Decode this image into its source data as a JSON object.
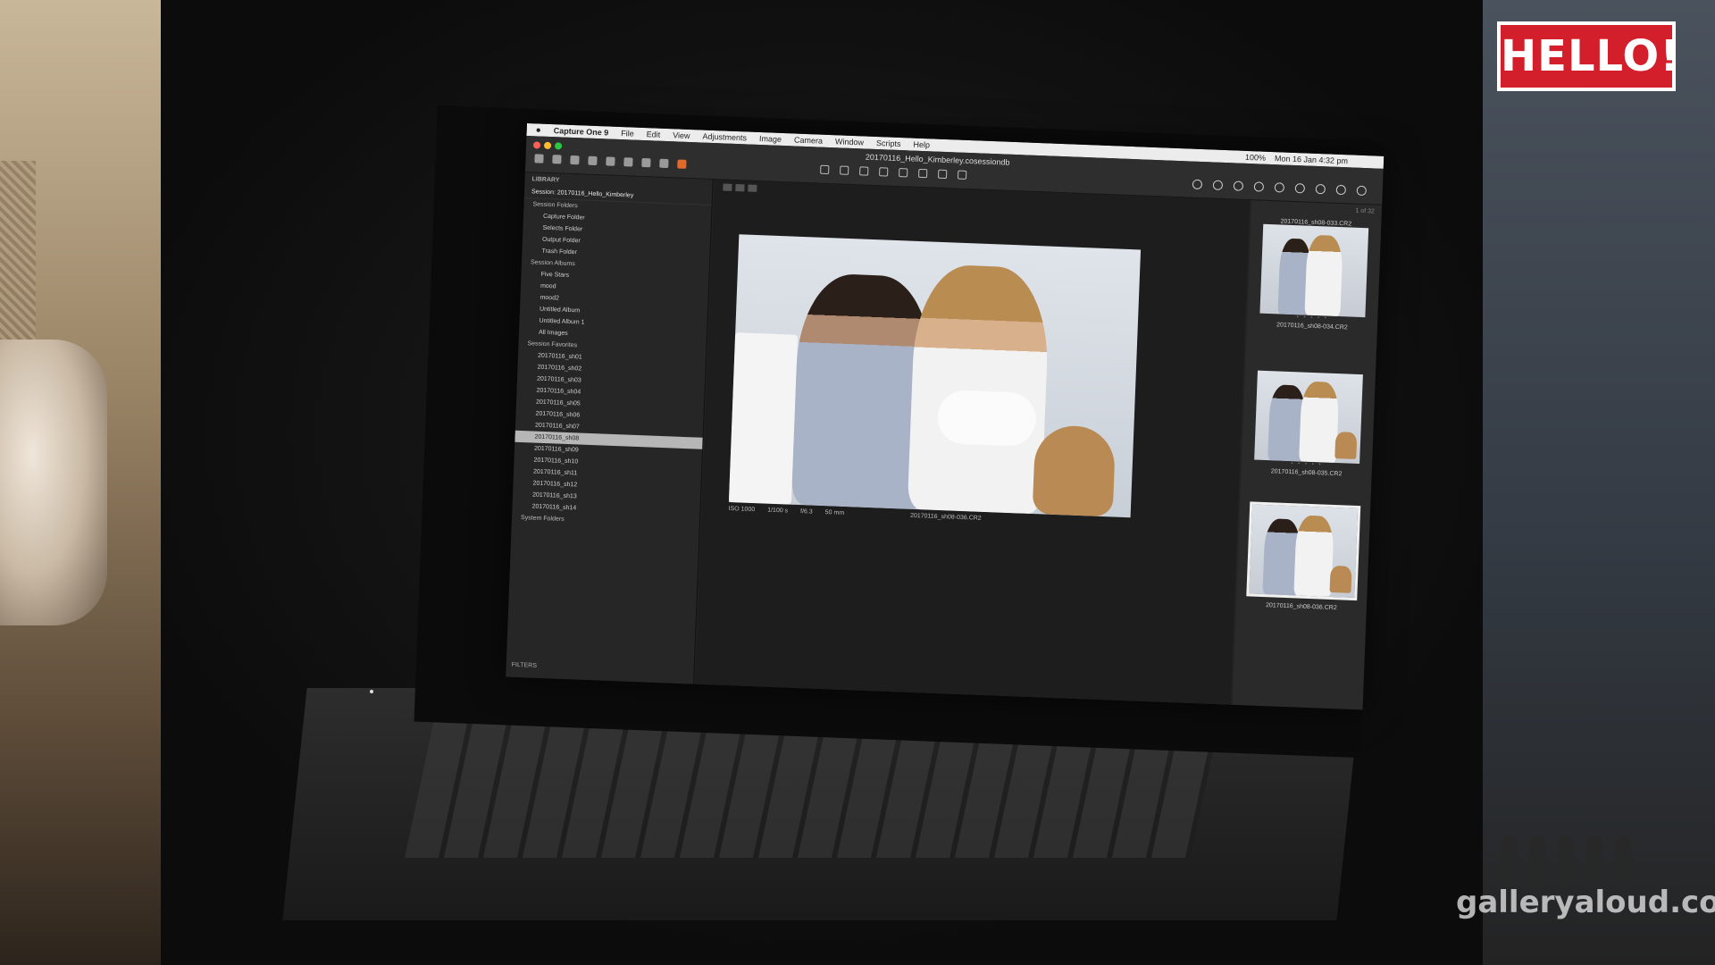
{
  "overlay": {
    "logo_text": "HELLO!",
    "watermark": "galleryaloud.com"
  },
  "menubar": {
    "apple": "",
    "app_name": "Capture One 9",
    "items": [
      "File",
      "Edit",
      "View",
      "Adjustments",
      "Image",
      "Camera",
      "Window",
      "Scripts",
      "Help"
    ],
    "status": [
      "100%",
      "Mon 16 Jan 4:32 pm"
    ]
  },
  "window": {
    "title": "20170116_Hello_Kimberley.cosessiondb"
  },
  "library": {
    "header": "LIBRARY",
    "session": "Session: 20170116_Hello_Kimberley",
    "session_folders_label": "Session Folders",
    "folders": [
      "Capture Folder",
      "Selects Folder",
      "Output Folder",
      "Trash Folder"
    ],
    "albums_label": "Session Albums",
    "albums": [
      "Five Stars",
      "mood",
      "mood2",
      "Untitled Album",
      "Untitled Album 1",
      "All Images"
    ],
    "favorites_label": "Session Favorites",
    "favorites": [
      "20170116_sh01",
      "20170116_sh02",
      "20170116_sh03",
      "20170116_sh04",
      "20170116_sh05",
      "20170116_sh06",
      "20170116_sh07",
      "20170116_sh08",
      "20170116_sh09",
      "20170116_sh10",
      "20170116_sh11",
      "20170116_sh12",
      "20170116_sh13",
      "20170116_sh14"
    ],
    "selected_index": 7,
    "system_folders_label": "System Folders",
    "filters_label": "FILTERS"
  },
  "viewer": {
    "meta": [
      "ISO 1000",
      "1/100 s",
      "f/6.3",
      "50 mm"
    ],
    "filename": "20170116_sh08-036.CR2"
  },
  "browser": {
    "counter": "1 of 32",
    "top_caption": "20170116_sh08-033.CR2",
    "thumbs": [
      {
        "caption": "20170116_sh08-034.CR2",
        "stars": "• • • • •"
      },
      {
        "caption": "20170116_sh08-035.CR2",
        "stars": "• • • • •"
      },
      {
        "caption": "20170116_sh08-036.CR2",
        "stars": "• • • • •"
      }
    ]
  },
  "colors": {
    "hello_red": "#d21f2b",
    "selected_row": "#b6b6b6",
    "accent_orange": "#e06a2a"
  }
}
